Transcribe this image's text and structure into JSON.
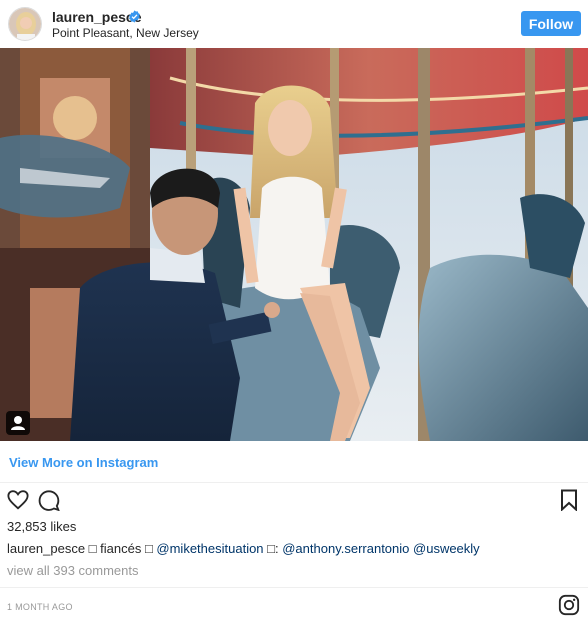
{
  "header": {
    "username": "lauren_pesce",
    "location": "Point Pleasant, New Jersey",
    "follow_label": "Follow",
    "verified_icon": "verified-badge-icon"
  },
  "photo": {
    "tag_icon": "person-tag-icon"
  },
  "view_more_label": "View More on Instagram",
  "actions": {
    "like_icon": "heart-icon",
    "comment_icon": "comment-icon",
    "save_icon": "bookmark-icon"
  },
  "likes": "32,853 likes",
  "caption": {
    "username": "lauren_pesce",
    "part1": " □ fiancés □ ",
    "mention1": "@mikethesituation",
    "part2": " □: ",
    "mention2": "@anthony.serrantonio",
    "part3": " ",
    "mention3": "@usweekly"
  },
  "view_all_comments": "view all 393 comments",
  "timestamp": "1 MONTH AGO",
  "colors": {
    "accent": "#3897f0",
    "text": "#262626",
    "muted": "#999999"
  }
}
